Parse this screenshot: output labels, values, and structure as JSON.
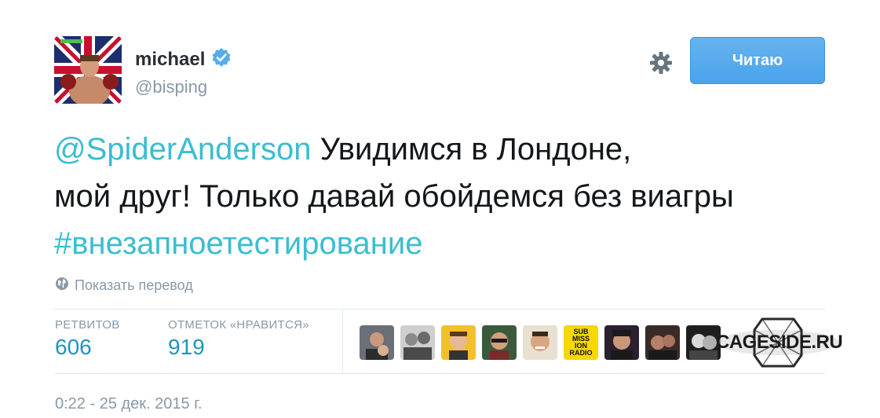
{
  "user": {
    "name": "michael",
    "handle": "@bisping",
    "verified": true
  },
  "header": {
    "follow_label": "Читаю"
  },
  "tweet": {
    "mention": "@SpiderAnderson",
    "text_line1": " Увидимся в Лондоне,",
    "text_line2": "мой друг! Только давай обойдемся без виагры",
    "hashtag": "#внезапноетестирование"
  },
  "translate": {
    "label": "Показать перевод"
  },
  "stats": {
    "retweets_label": "РЕТВИТОВ",
    "retweets_value": "606",
    "likes_label": "ОТМЕТОК «НРАВИТСЯ»",
    "likes_value": "919"
  },
  "likers": {
    "count": 9,
    "badge_lines": [
      "SUB",
      "MISS",
      "ION",
      "RADIO"
    ]
  },
  "watermark": {
    "text": "CAGESIDE.RU"
  },
  "timestamp": "0:22 - 25 дек. 2015 г.",
  "colors": {
    "link": "#3bbdd0",
    "follow_button": "#55acee",
    "stat_value": "#1b95c0",
    "muted": "#8899a6"
  },
  "icons": {
    "settings": "gear-icon",
    "verified": "verified-badge-icon",
    "translate": "globe-icon"
  }
}
